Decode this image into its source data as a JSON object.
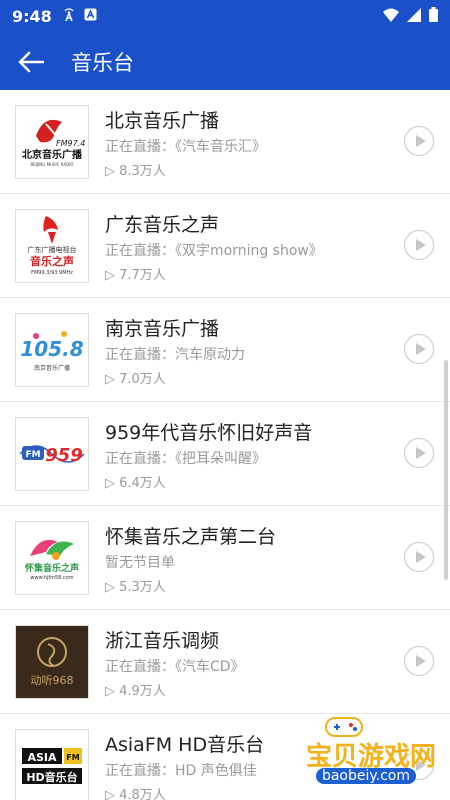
{
  "status": {
    "time": "9:48"
  },
  "appbar": {
    "title": "音乐台"
  },
  "stations": [
    {
      "name": "北京音乐广播",
      "live": "正在直播：《汽车音乐汇》",
      "plays": "▷ 8.3万人"
    },
    {
      "name": "广东音乐之声",
      "live": "正在直播：《双宇morning show》",
      "plays": "▷ 7.7万人"
    },
    {
      "name": "南京音乐广播",
      "live": "正在直播：汽车原动力",
      "plays": "▷ 7.0万人"
    },
    {
      "name": "959年代音乐怀旧好声音",
      "live": "正在直播：《把耳朵叫醒》",
      "plays": "▷ 6.4万人"
    },
    {
      "name": "怀集音乐之声第二台",
      "live": "暂无节目单",
      "plays": "▷ 5.3万人"
    },
    {
      "name": "浙江音乐调频",
      "live": "正在直播：《汽车CD》",
      "plays": "▷ 4.9万人"
    },
    {
      "name": "AsiaFM HD音乐台",
      "live": "正在直播：HD 声色俱佳",
      "plays": "▷ 4.8万人"
    }
  ],
  "logos": {
    "beijing": {
      "freq": "FM97.4",
      "name": "北京音乐广播",
      "sub": "BEIJING MUSIC RADIO"
    },
    "guangdong": {
      "top": "广东广播电视台",
      "name": "音乐之声",
      "freq": "FM99.3/93.9MHz"
    },
    "nanjing": {
      "freq": "105.8",
      "sub": "南京音乐广播"
    },
    "fm959": {
      "freq": "959",
      "fm": "FM"
    },
    "huaiji": {
      "name": "怀集音乐之声",
      "url": "www.hjfm58.com"
    },
    "zhejiang": {
      "name": "动听968"
    },
    "asia": {
      "brand": "ASIA",
      "fm": "FM",
      "name": "HD音乐台"
    }
  },
  "watermark": {
    "text": "宝贝游戏网",
    "url": "baobeiy.com"
  },
  "colors": {
    "primary": "#1a50c8",
    "accent": "#f1b21a"
  }
}
